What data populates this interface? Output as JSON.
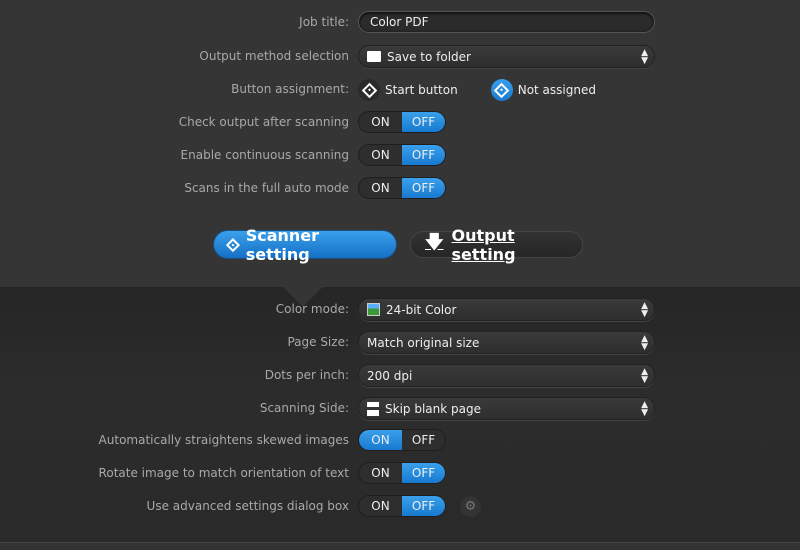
{
  "job": {
    "title_label": "Job title:",
    "title_value": "Color PDF",
    "output_method_label": "Output method selection",
    "output_method_value": "Save to folder",
    "button_assignment_label": "Button assignment:",
    "button_options": [
      "Start button",
      "Not assigned"
    ],
    "button_selected": "Not assigned",
    "toggles": [
      {
        "label": "Check output after scanning",
        "on": "ON",
        "off": "OFF",
        "value": "OFF"
      },
      {
        "label": "Enable continuous scanning",
        "on": "ON",
        "off": "OFF",
        "value": "OFF"
      },
      {
        "label": "Scans in the full auto mode",
        "on": "ON",
        "off": "OFF",
        "value": "OFF"
      }
    ]
  },
  "tabs": {
    "scanner": "Scanner setting",
    "output": "Output setting",
    "active": "scanner"
  },
  "scanner": {
    "selects": [
      {
        "label": "Color mode:",
        "value": "24-bit Color",
        "icon": "color-image-icon"
      },
      {
        "label": "Page Size:",
        "value": "Match original size"
      },
      {
        "label": "Dots per inch:",
        "value": "200 dpi"
      },
      {
        "label": "Scanning Side:",
        "value": "Skip blank page",
        "icon": "pages-icon"
      }
    ],
    "toggles": [
      {
        "label": "Automatically straightens skewed images",
        "on": "ON",
        "off": "OFF",
        "value": "ON"
      },
      {
        "label": "Rotate image to match orientation of text",
        "on": "ON",
        "off": "OFF",
        "value": "OFF"
      },
      {
        "label": "Use advanced settings dialog box",
        "on": "ON",
        "off": "OFF",
        "value": "OFF"
      }
    ]
  },
  "colors": {
    "accent": "#1f86dc",
    "bg_top": "#353535",
    "bg_bottom": "#2a2a2a"
  }
}
